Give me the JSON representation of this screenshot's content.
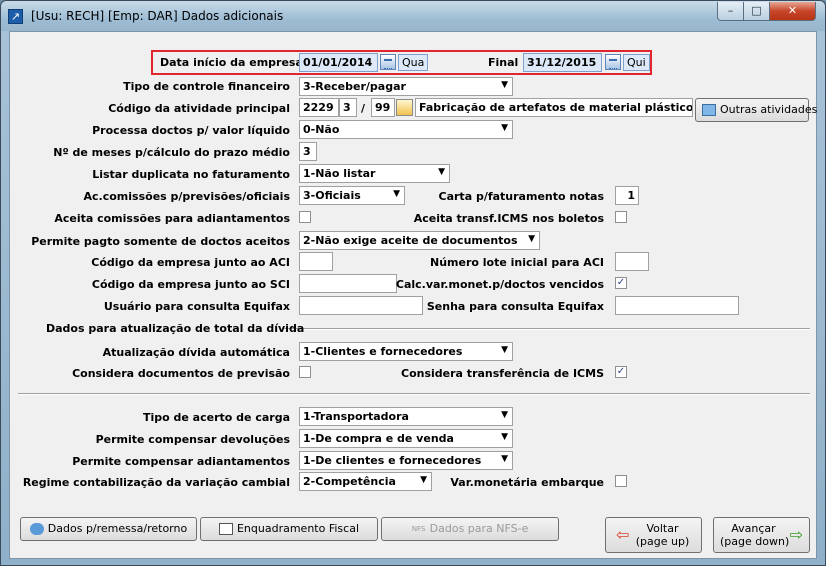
{
  "window": {
    "title": "[Usu: RECH] [Emp: DAR] Dados adicionais",
    "min_glyph": "–",
    "max_glyph": "□",
    "close_glyph": "✕"
  },
  "period": {
    "start_label": "Data início da empresa",
    "start_value": "01/01/2014",
    "start_weekday": "Qua",
    "end_label": "Final",
    "end_value": "31/12/2015",
    "end_weekday": "Qui"
  },
  "form": {
    "tipo_controle": {
      "label": "Tipo de controle financeiro",
      "value": "3-Receber/pagar"
    },
    "codigo_atividade": {
      "label": "Código da atividade principal",
      "part1": "2229",
      "part2": "3",
      "sep": "/",
      "part3": "99",
      "description": "Fabricação de artefatos de material plástico par",
      "outras_label": "Outras atividades"
    },
    "processa_doctos": {
      "label": "Processa doctos p/ valor líquido",
      "value": "0-Não"
    },
    "meses_prazo": {
      "label": "Nº de meses p/cálculo do prazo médio",
      "value": "3"
    },
    "listar_duplicata": {
      "label": "Listar duplicata no faturamento",
      "value": "1-Não listar"
    },
    "comissoes": {
      "label": "Ac.comissões p/previsões/oficiais",
      "value": "3-Oficiais"
    },
    "carta_faturamento": {
      "label": "Carta p/faturamento notas",
      "value": "1"
    },
    "aceita_comissoes": {
      "label": "Aceita comissões para adiantamentos",
      "checked": false
    },
    "aceita_transf_icms": {
      "label": "Aceita transf.ICMS nos boletos",
      "checked": false
    },
    "permite_pagto": {
      "label": "Permite pagto somente de doctos aceitos",
      "value": "2-Não exige aceite de documentos"
    },
    "codigo_aci": {
      "label": "Código da empresa junto ao ACI",
      "value": ""
    },
    "lote_aci": {
      "label": "Número lote inicial para ACI",
      "value": ""
    },
    "codigo_sci": {
      "label": "Código da empresa junto ao SCI",
      "value": ""
    },
    "calc_var_monet": {
      "label": "Calc.var.monet.p/doctos vencidos",
      "checked": true
    },
    "usuario_equifax": {
      "label": "Usuário para consulta Equifax",
      "value": ""
    },
    "senha_equifax": {
      "label": "Senha para consulta Equifax",
      "value": ""
    }
  },
  "divida": {
    "section_label": "Dados para atualização de total da dívida",
    "atualizacao": {
      "label": "Atualização dívida automática",
      "value": "1-Clientes e fornecedores"
    },
    "considera_previsao": {
      "label": "Considera documentos de previsão",
      "checked": false
    },
    "considera_transf_icms": {
      "label": "Considera transferência de ICMS",
      "checked": true
    }
  },
  "carga": {
    "tipo_acerto": {
      "label": "Tipo de acerto de carga",
      "value": "1-Transportadora"
    },
    "compensar_devolucoes": {
      "label": "Permite compensar devoluções",
      "value": "1-De compra e de venda"
    },
    "compensar_adiantamentos": {
      "label": "Permite compensar adiantamentos",
      "value": "1-De clientes e fornecedores"
    },
    "regime_cambial": {
      "label": "Regime contabilização da variação cambial",
      "value": "2-Competência"
    },
    "var_monetaria_embarque": {
      "label": "Var.monetária embarque",
      "checked": false
    }
  },
  "buttons": {
    "dados_remessa": "Dados p/remessa/retorno",
    "enquadramento": "Enquadramento Fiscal",
    "dados_nfse": "Dados para NFS-e",
    "nfs_icon_text": "NFS",
    "voltar": "Voltar",
    "voltar_hint": "(page up)",
    "avancar": "Avançar",
    "avancar_hint": "(page down)"
  },
  "glyphs": {
    "dropdown": "▼",
    "check": "✓",
    "back_arrow": "⇦",
    "forward_arrow": "⇨"
  },
  "colors": {
    "highlight_box": "#e0262f",
    "selected_field": "#dde9f8"
  }
}
